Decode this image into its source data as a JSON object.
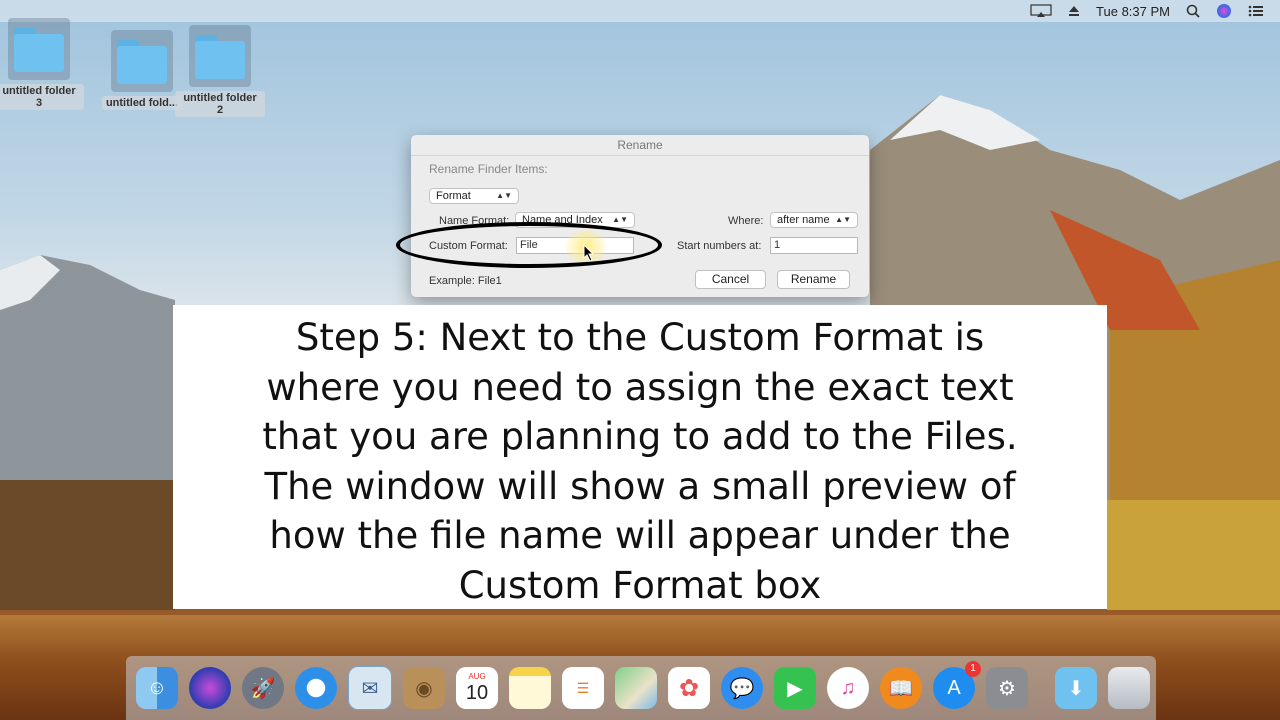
{
  "menubar": {
    "clock": "Tue 8:37 PM",
    "icons": [
      "airplay-icon",
      "eject-icon",
      "search-icon",
      "siri-icon",
      "notification-center-icon"
    ]
  },
  "desktop": {
    "folders": [
      {
        "label": "untitled folder 3"
      },
      {
        "label": "untitled fold..."
      },
      {
        "label": "untitled folder 2"
      }
    ]
  },
  "dialog": {
    "title": "Rename",
    "heading": "Rename Finder Items:",
    "mode_value": "Format",
    "name_format_label": "Name Format:",
    "name_format_value": "Name and Index",
    "where_label": "Where:",
    "where_value": "after name",
    "custom_format_label": "Custom Format:",
    "custom_format_value": "File",
    "start_numbers_label": "Start numbers at:",
    "start_numbers_value": "1",
    "example_text": "Example: File1",
    "cancel_label": "Cancel",
    "rename_label": "Rename"
  },
  "caption": {
    "lines": [
      "Step 5: Next to the Custom Format is",
      "where you need to assign the exact text",
      "that you are planning to add to the Files.",
      "The window will show a small preview of",
      "how the file name will appear under the",
      "Custom Format box"
    ]
  },
  "dock": {
    "calendar_month": "AUG",
    "calendar_day": "10",
    "app_store_badge": "1",
    "apps": [
      "finder-icon",
      "siri-icon",
      "launchpad-icon",
      "safari-icon",
      "mail-icon",
      "contacts-icon",
      "calendar-icon",
      "notes-icon",
      "reminders-icon",
      "maps-icon",
      "photos-icon",
      "messages-icon",
      "facetime-icon",
      "itunes-icon",
      "ibooks-icon",
      "app-store-icon",
      "system-preferences-icon",
      "downloads-folder-icon",
      "trash-icon"
    ]
  },
  "colors": {
    "folder_blue": "#6fc1ef",
    "badge_red": "#e33333"
  }
}
